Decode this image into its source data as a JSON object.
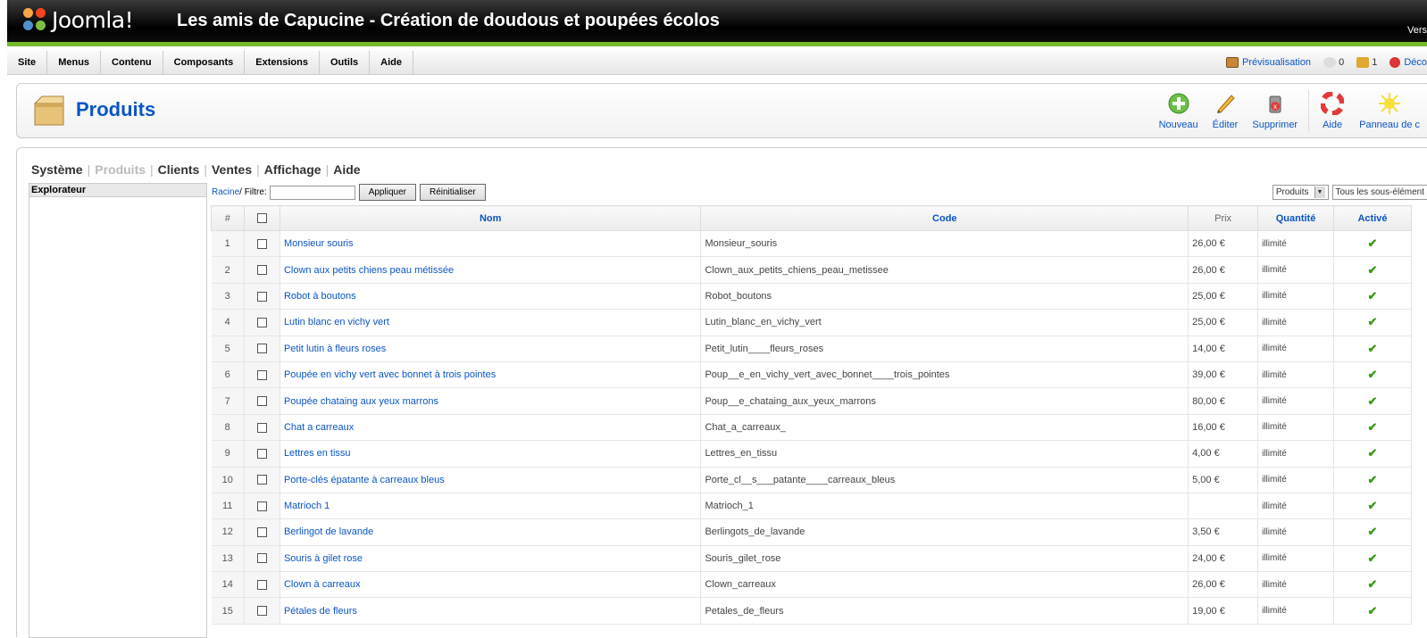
{
  "header": {
    "logo_text": "Joomla!",
    "site_title": "Les amis de Capucine - Création de doudous et poupées écolos",
    "version": "Vers"
  },
  "menu": {
    "items": [
      "Site",
      "Menus",
      "Contenu",
      "Composants",
      "Extensions",
      "Outils",
      "Aide"
    ],
    "preview": "Prévisualisation",
    "messages": "0",
    "users": "1",
    "logout": "Déco"
  },
  "toolbar": {
    "title": "Produits",
    "new": "Nouveau",
    "edit": "Éditer",
    "delete": "Supprimer",
    "help": "Aide",
    "panel": "Panneau de c"
  },
  "subnav": [
    "Système",
    "Produits",
    "Clients",
    "Ventes",
    "Affichage",
    "Aide"
  ],
  "explorer": {
    "title": "Explorateur"
  },
  "filter": {
    "root": "Racine",
    "label": "/ Filtre:",
    "value": "",
    "apply": "Appliquer",
    "reset": "Réinitialiser",
    "select1": "Produits",
    "select2": "Tous les sous-élément"
  },
  "table": {
    "headers": [
      "#",
      "",
      "Nom",
      "Code",
      "Prix",
      "Quantité",
      "Activé"
    ],
    "rows": [
      {
        "n": "1",
        "name": "Monsieur souris",
        "code": "Monsieur_souris",
        "price": "26,00 €",
        "qty": "illimité"
      },
      {
        "n": "2",
        "name": "Clown aux petits chiens peau métissée",
        "code": "Clown_aux_petits_chiens_peau_metissee",
        "price": "26,00 €",
        "qty": "illimité"
      },
      {
        "n": "3",
        "name": "Robot à boutons",
        "code": "Robot_boutons",
        "price": "25,00 €",
        "qty": "illimité"
      },
      {
        "n": "4",
        "name": "Lutin blanc en vichy vert",
        "code": "Lutin_blanc_en_vichy_vert",
        "price": "25,00 €",
        "qty": "illimité"
      },
      {
        "n": "5",
        "name": "Petit lutin à fleurs roses",
        "code": "Petit_lutin____fleurs_roses",
        "price": "14,00 €",
        "qty": "illimité"
      },
      {
        "n": "6",
        "name": "Poupée en vichy vert avec bonnet à trois pointes",
        "code": "Poup__e_en_vichy_vert_avec_bonnet____trois_pointes",
        "price": "39,00 €",
        "qty": "illimité"
      },
      {
        "n": "7",
        "name": "Poupée chataing aux yeux marrons",
        "code": "Poup__e_chataing_aux_yeux_marrons",
        "price": "80,00 €",
        "qty": "illimité"
      },
      {
        "n": "8",
        "name": "Chat a carreaux",
        "code": "Chat_a_carreaux_",
        "price": "16,00 €",
        "qty": "illimité"
      },
      {
        "n": "9",
        "name": "Lettres en tissu",
        "code": "Lettres_en_tissu",
        "price": "4,00 €",
        "qty": "illimité"
      },
      {
        "n": "10",
        "name": "Porte-clés épatante à carreaux bleus",
        "code": "Porte_cl__s___patante____carreaux_bleus",
        "price": "5,00 €",
        "qty": "illimité"
      },
      {
        "n": "11",
        "name": "Matrioch 1",
        "code": "Matrioch_1",
        "price": "",
        "qty": "illimité"
      },
      {
        "n": "12",
        "name": "Berlingot de lavande",
        "code": "Berlingots_de_lavande",
        "price": "3,50 €",
        "qty": "illimité"
      },
      {
        "n": "13",
        "name": "Souris à gilet rose",
        "code": "Souris_gilet_rose",
        "price": "24,00 €",
        "qty": "illimité"
      },
      {
        "n": "14",
        "name": "Clown à carreaux",
        "code": "Clown_carreaux",
        "price": "26,00 €",
        "qty": "illimité"
      },
      {
        "n": "15",
        "name": "Pétales de fleurs",
        "code": "Petales_de_fleurs",
        "price": "19,00 €",
        "qty": "illimité"
      }
    ]
  },
  "colors": {
    "link": "#0b55c4",
    "accent_green": "#74b92a",
    "tick": "#3a9a1a"
  }
}
